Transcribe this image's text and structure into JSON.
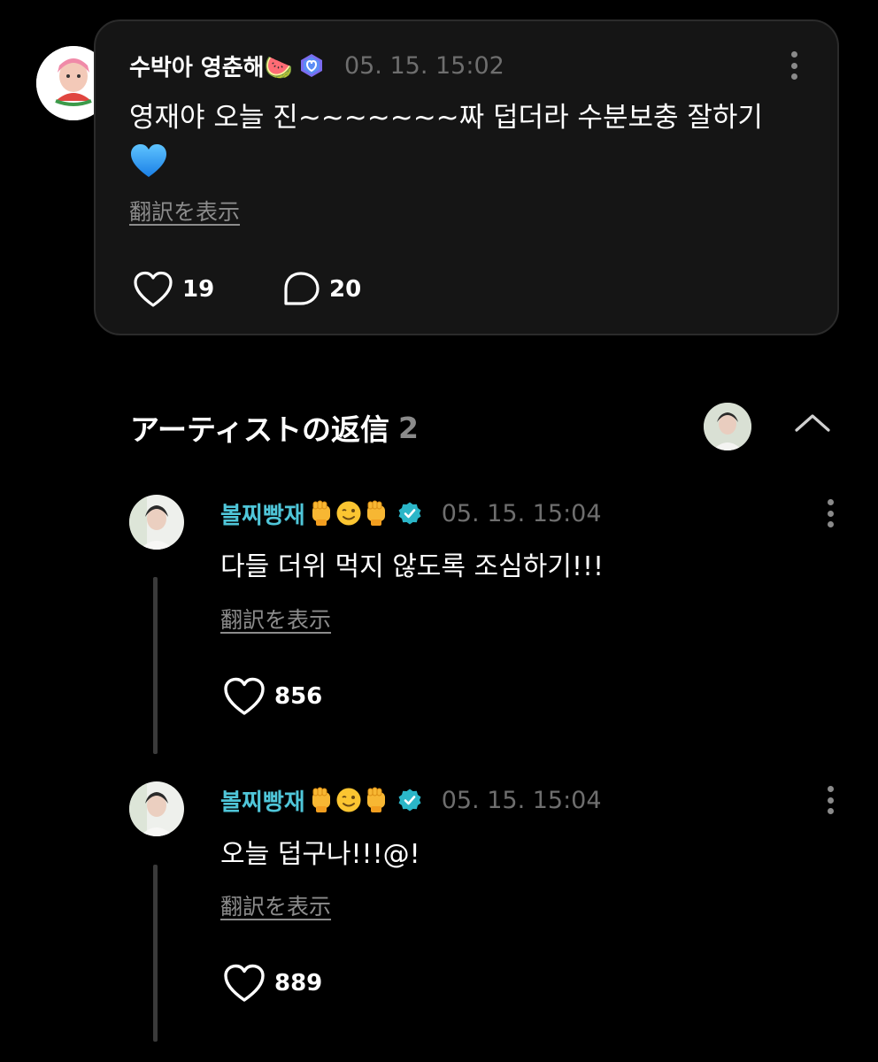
{
  "post": {
    "author": "수박아 영춘해🍉",
    "timestamp": "05. 15. 15:02",
    "text": "영재야 오늘 진~~~~~~~짜 덥더라 수분보충 잘하기",
    "emoji_icon": "blue-heart-icon",
    "translate_label": "翻訳を表示",
    "like_count": "19",
    "comment_count": "20"
  },
  "replies_section": {
    "title": "アーティストの返信",
    "count": "2"
  },
  "replies": [
    {
      "author": "볼찌빵재",
      "timestamp": "05. 15. 15:04",
      "text": "다들 더위 먹지 않도록 조심하기!!!",
      "translate_label": "翻訳を表示",
      "like_count": "856"
    },
    {
      "author": "볼찌빵재",
      "timestamp": "05. 15. 15:04",
      "text": "오늘 덥구나!!!@!",
      "translate_label": "翻訳を表示",
      "like_count": "889"
    }
  ],
  "colors": {
    "background": "#000000",
    "card": "#151515",
    "artist_name": "#4fc6d9",
    "muted": "#8c8c8c",
    "verified": "#2bb6c8"
  }
}
